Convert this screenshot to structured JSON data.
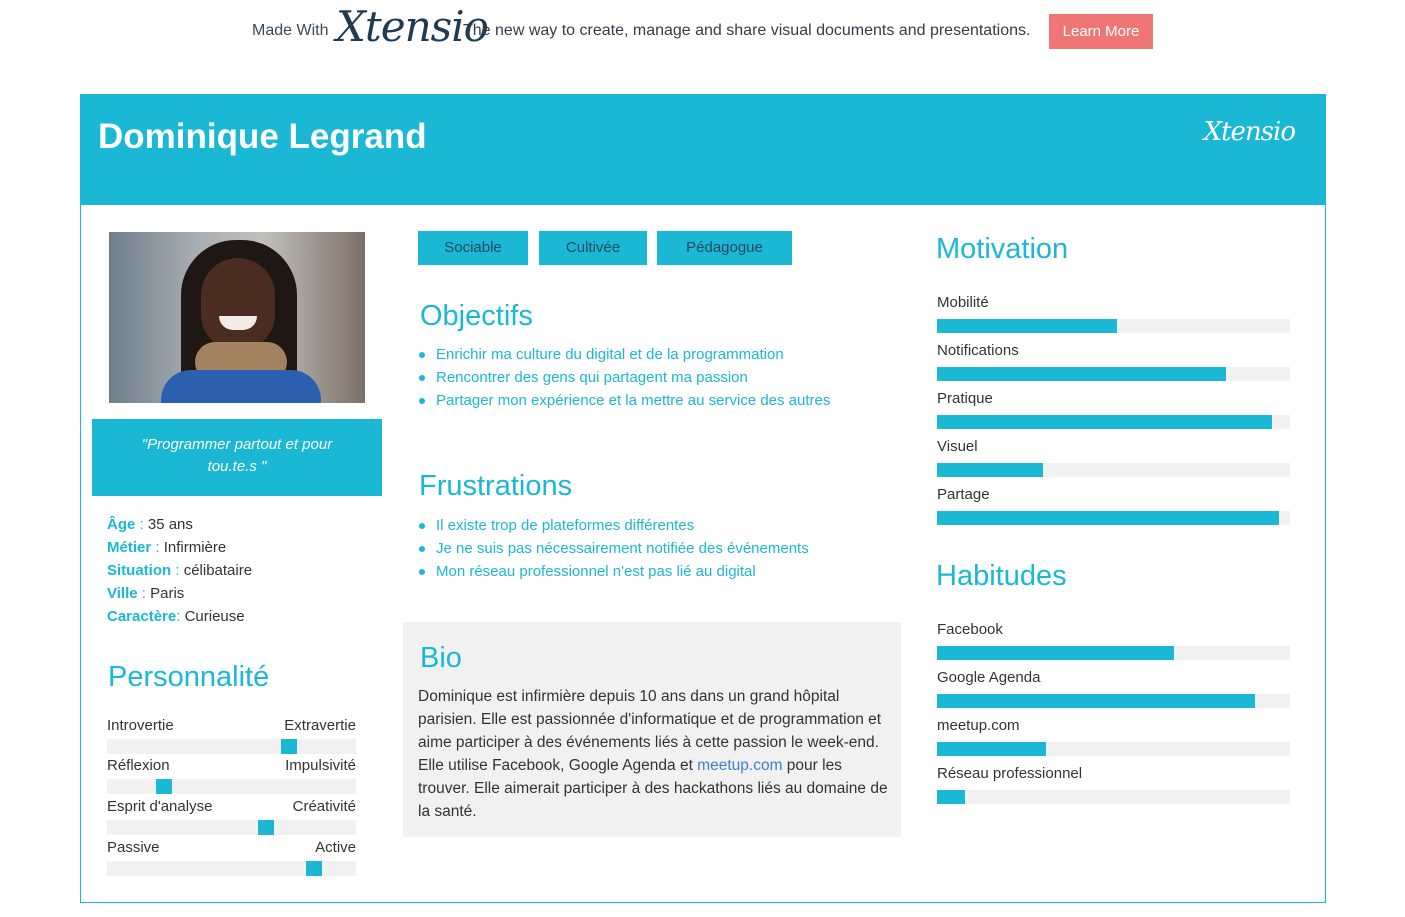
{
  "promo": {
    "made_with": "Made With",
    "brand": "Xtensio",
    "tagline": "The new way to create, manage and share visual documents and presentations.",
    "learn_more": "Learn More"
  },
  "persona": {
    "name": "Dominique Legrand",
    "logo": "Xtensio",
    "quote": "\"Programmer partout et pour tou.te.s \"",
    "facts": [
      {
        "key": "Âge",
        "sep": " : ",
        "value": "35 ans"
      },
      {
        "key": "Métier",
        "sep": " : ",
        "value": "Infirmière"
      },
      {
        "key": "Situation",
        "sep": " : ",
        "value": "célibataire"
      },
      {
        "key": "Ville",
        "sep": " : ",
        "value": "Paris"
      },
      {
        "key": "Caractère",
        "sep": ": ",
        "value": "Curieuse"
      }
    ],
    "tags": [
      "Sociable",
      "Cultivée",
      "Pédagogue"
    ]
  },
  "personality": {
    "title": "Personnalité",
    "traits": [
      {
        "left": "Introvertie",
        "right": "Extravertie",
        "level": 0.73
      },
      {
        "left": "Réflexion",
        "right": "Impulsivité",
        "level": 0.23
      },
      {
        "left": "Esprit d'analyse",
        "right": "Créativité",
        "level": 0.64
      },
      {
        "left": "Passive",
        "right": "Active",
        "level": 0.83
      }
    ]
  },
  "objectifs": {
    "title": "Objectifs",
    "items": [
      "Enrichir ma culture du digital et de la programmation",
      "Rencontrer des gens qui partagent ma passion",
      "Partager mon expérience et la mettre au service des autres"
    ]
  },
  "frustrations": {
    "title": "Frustrations",
    "items": [
      "Il existe trop de plateformes différentes",
      "Je ne suis pas nécessairement notifiée des événements",
      "Mon réseau professionnel n'est pas lié au digital"
    ]
  },
  "bio": {
    "title": "Bio",
    "text_before": "Dominique est infirmière depuis 10 ans dans un grand hôpital parisien. Elle est passionnée d'informatique et de programmation et aime participer à des événements liés à cette passion le week-end. Elle utilise Facebook, Google Agenda et ",
    "link": "meetup.com",
    "text_after": " pour les trouver. Elle aimerait participer à des hackathons liés au domaine de la santé."
  },
  "motivation": {
    "title": "Motivation",
    "items": [
      {
        "label": "Mobilité",
        "level": 0.51
      },
      {
        "label": "Notifications",
        "level": 0.82
      },
      {
        "label": "Pratique",
        "level": 0.95
      },
      {
        "label": "Visuel",
        "level": 0.3
      },
      {
        "label": "Partage",
        "level": 0.97
      }
    ]
  },
  "habitudes": {
    "title": "Habitudes",
    "items": [
      {
        "label": "Facebook",
        "level": 0.67
      },
      {
        "label": "Google Agenda",
        "level": 0.9
      },
      {
        "label": "meetup.com",
        "level": 0.31
      },
      {
        "label": "Réseau professionnel",
        "level": 0.08
      }
    ]
  },
  "colors": {
    "accent": "#1ab8d4",
    "cta": "#f07575",
    "panel": "#f1f1f1"
  }
}
